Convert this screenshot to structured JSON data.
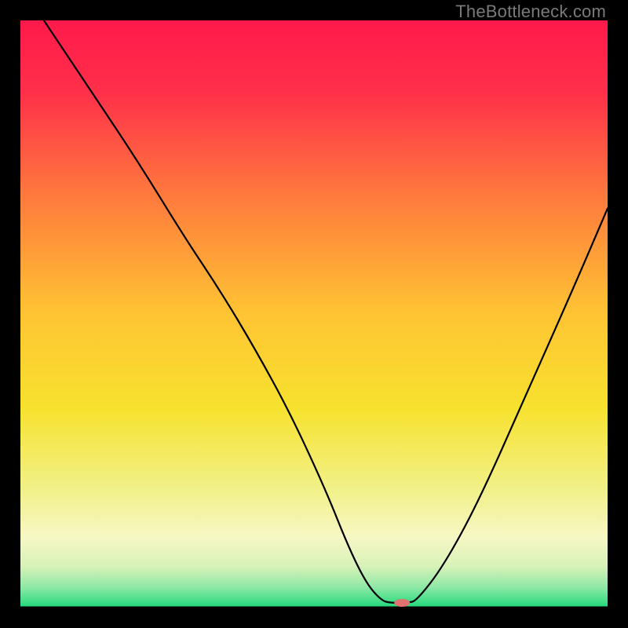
{
  "watermark": "TheBottleneck.com",
  "chart_data": {
    "type": "line",
    "title": "",
    "xlabel": "",
    "ylabel": "",
    "xlim": [
      0,
      100
    ],
    "ylim": [
      0,
      100
    ],
    "background_gradient": [
      {
        "pos": 0.0,
        "color": "#ff1a4b"
      },
      {
        "pos": 0.12,
        "color": "#ff2f4a"
      },
      {
        "pos": 0.3,
        "color": "#ff7a3d"
      },
      {
        "pos": 0.5,
        "color": "#ffc433"
      },
      {
        "pos": 0.66,
        "color": "#f7e22e"
      },
      {
        "pos": 0.8,
        "color": "#f1f18a"
      },
      {
        "pos": 0.88,
        "color": "#f7f7c5"
      },
      {
        "pos": 0.93,
        "color": "#d7f2b8"
      },
      {
        "pos": 0.965,
        "color": "#8fe8a6"
      },
      {
        "pos": 1.0,
        "color": "#1fd97a"
      }
    ],
    "series": [
      {
        "name": "bottleneck-curve",
        "stroke": "#000000",
        "stroke_width": 2.2,
        "x": [
          4,
          12,
          20,
          28,
          34,
          40,
          46,
          52,
          56,
          59,
          61.5,
          63,
          66,
          67.5,
          72,
          78,
          86,
          94,
          100
        ],
        "y": [
          100,
          88,
          76,
          63,
          54,
          44,
          33,
          20,
          10,
          4,
          1.2,
          0.8,
          0.8,
          1.2,
          7,
          18,
          36,
          54,
          68
        ]
      }
    ],
    "flat_segment": {
      "x1": 61.5,
      "x2": 67.5,
      "y": 0.8
    },
    "marker": {
      "name": "optimum-marker",
      "x": 65,
      "y": 0.8,
      "rx": 10,
      "ry": 5,
      "fill": "#e0726f"
    },
    "baseline": {
      "y": 0,
      "stroke": "#000000",
      "stroke_width": 3
    }
  }
}
